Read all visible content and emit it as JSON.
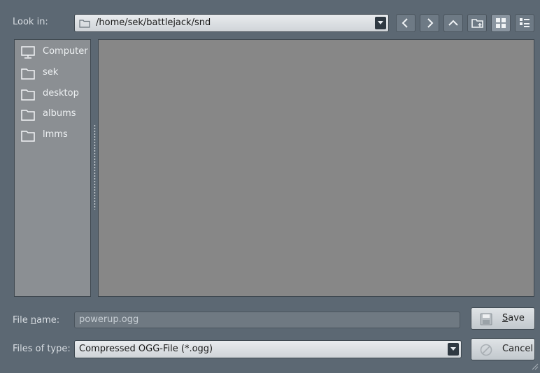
{
  "lookin": {
    "label": "Look in:",
    "path": "/home/sek/battlejack/snd"
  },
  "toolbar": {
    "icons": [
      "back-icon",
      "forward-icon",
      "parent-dir-icon",
      "new-folder-icon",
      "icon-view-icon",
      "detail-view-icon"
    ]
  },
  "sidebar": {
    "items": [
      {
        "label": "Computer",
        "icon": "computer-icon"
      },
      {
        "label": "sek",
        "icon": "folder-icon"
      },
      {
        "label": "desktop",
        "icon": "folder-icon"
      },
      {
        "label": "albums",
        "icon": "folder-icon"
      },
      {
        "label": "lmms",
        "icon": "folder-icon"
      }
    ]
  },
  "filename": {
    "label_prefix": "File ",
    "label_accel": "n",
    "label_suffix": "ame:",
    "value": "powerup.ogg"
  },
  "filetype": {
    "label": "Files of type:",
    "value": "Compressed OGG-File (*.ogg)"
  },
  "buttons": {
    "save": "Save",
    "cancel": "Cancel"
  }
}
